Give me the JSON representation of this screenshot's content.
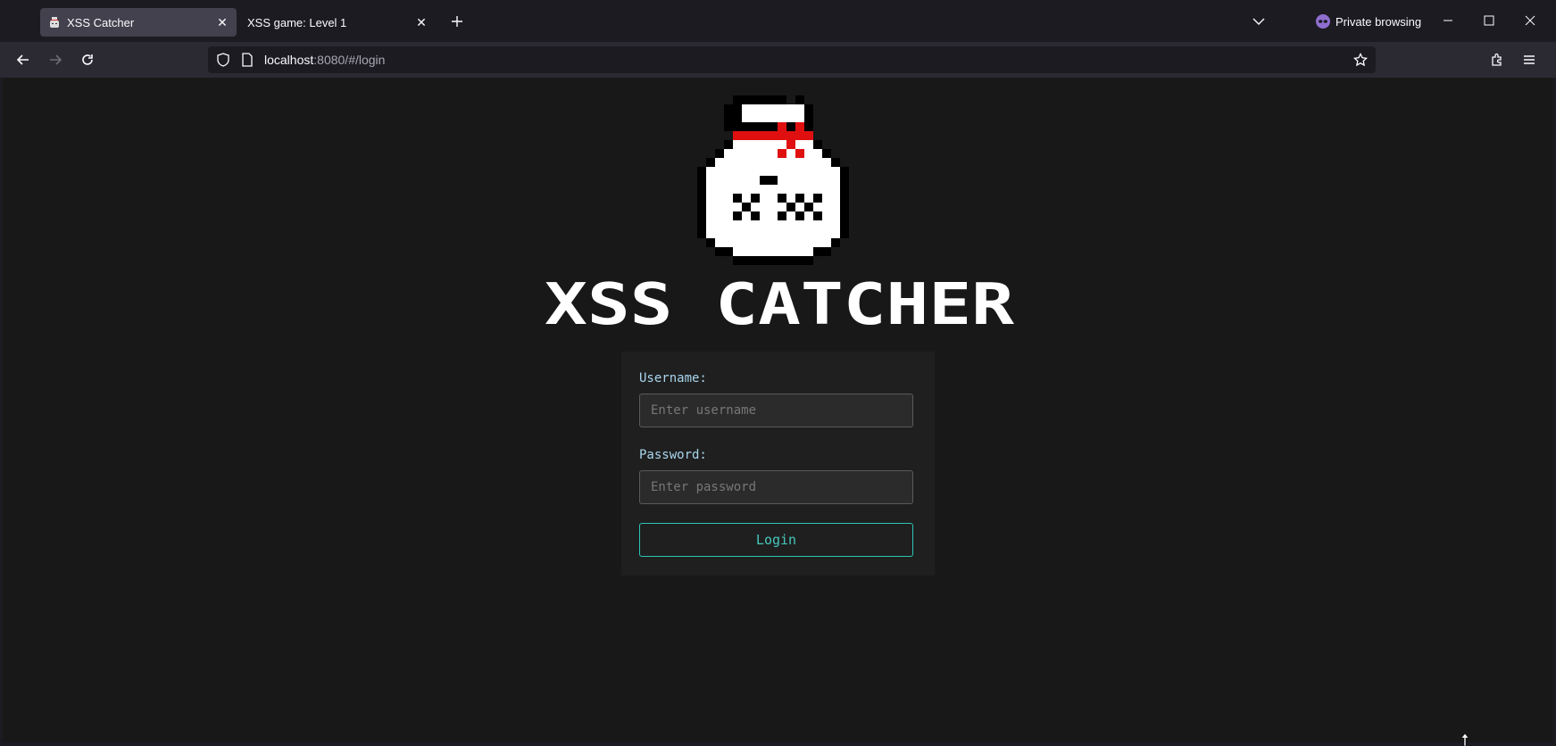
{
  "browser": {
    "tabs": [
      {
        "title": "XSS Catcher",
        "active": true
      },
      {
        "title": "XSS game: Level 1",
        "active": false
      }
    ],
    "private_label": "Private browsing",
    "url_host": "localhost",
    "url_rest": ":8080/#/login"
  },
  "page": {
    "brand_title": "XSS CATCHER",
    "username_label": "Username:",
    "username_placeholder": "Enter username",
    "password_label": "Password:",
    "password_placeholder": "Enter password",
    "login_label": "Login"
  },
  "colors": {
    "background": "#181818",
    "label": "#a8d6ee",
    "accent": "#2ec4b6",
    "ribbon": "#e01010"
  }
}
